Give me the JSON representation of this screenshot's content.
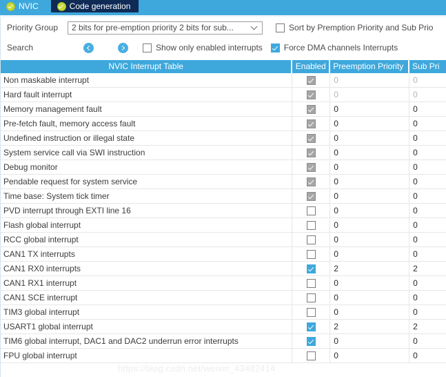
{
  "tabs": [
    {
      "label": "NVIC",
      "icon": "check-circle-icon",
      "active": true
    },
    {
      "label": "Code generation",
      "icon": "check-circle-icon",
      "active": false
    }
  ],
  "controls": {
    "priority_group_label": "Priority Group",
    "priority_group_value": "2 bits for pre-emption priority 2 bits for sub...",
    "sort_checkbox_label": "Sort by Premption Priority and Sub Prio",
    "sort_checkbox_checked": false,
    "search_label": "Search",
    "prev_icon": "chevron-left-circle-icon",
    "next_icon": "chevron-right-circle-icon",
    "show_enabled_label": "Show only enabled interrupts",
    "show_enabled_checked": false,
    "force_dma_label": "Force DMA channels Interrupts",
    "force_dma_checked": true
  },
  "table": {
    "headers": {
      "name": "NVIC Interrupt Table",
      "enabled": "Enabled",
      "preemption": "Preemption Priority",
      "sub": "Sub Pri"
    },
    "rows": [
      {
        "name": "Non maskable interrupt",
        "enabled": "checked-gray",
        "preemption": "0",
        "sub": "0",
        "dim": true
      },
      {
        "name": "Hard fault interrupt",
        "enabled": "checked-gray",
        "preemption": "0",
        "sub": "0",
        "dim": true
      },
      {
        "name": "Memory management fault",
        "enabled": "checked-gray",
        "preemption": "0",
        "sub": "0",
        "dim": false
      },
      {
        "name": "Pre-fetch fault, memory access fault",
        "enabled": "checked-gray",
        "preemption": "0",
        "sub": "0",
        "dim": false
      },
      {
        "name": "Undefined instruction or illegal state",
        "enabled": "checked-gray",
        "preemption": "0",
        "sub": "0",
        "dim": false
      },
      {
        "name": "System service call via SWI instruction",
        "enabled": "checked-gray",
        "preemption": "0",
        "sub": "0",
        "dim": false
      },
      {
        "name": "Debug monitor",
        "enabled": "checked-gray",
        "preemption": "0",
        "sub": "0",
        "dim": false
      },
      {
        "name": "Pendable request for system service",
        "enabled": "checked-gray",
        "preemption": "0",
        "sub": "0",
        "dim": false
      },
      {
        "name": "Time base: System tick timer",
        "enabled": "checked-gray",
        "preemption": "0",
        "sub": "0",
        "dim": false
      },
      {
        "name": "PVD interrupt through EXTI line 16",
        "enabled": "unchecked",
        "preemption": "0",
        "sub": "0",
        "dim": false
      },
      {
        "name": "Flash global interrupt",
        "enabled": "unchecked",
        "preemption": "0",
        "sub": "0",
        "dim": false
      },
      {
        "name": "RCC global interrupt",
        "enabled": "unchecked",
        "preemption": "0",
        "sub": "0",
        "dim": false
      },
      {
        "name": "CAN1 TX interrupts",
        "enabled": "unchecked",
        "preemption": "0",
        "sub": "0",
        "dim": false
      },
      {
        "name": "CAN1 RX0 interrupts",
        "enabled": "checked-blue",
        "preemption": "2",
        "sub": "2",
        "dim": false
      },
      {
        "name": "CAN1 RX1 interrupt",
        "enabled": "unchecked",
        "preemption": "0",
        "sub": "0",
        "dim": false
      },
      {
        "name": "CAN1 SCE interrupt",
        "enabled": "unchecked",
        "preemption": "0",
        "sub": "0",
        "dim": false
      },
      {
        "name": "TIM3 global interrupt",
        "enabled": "unchecked",
        "preemption": "0",
        "sub": "0",
        "dim": false
      },
      {
        "name": "USART1 global interrupt",
        "enabled": "checked-blue",
        "preemption": "2",
        "sub": "2",
        "dim": false
      },
      {
        "name": "TIM6 global interrupt, DAC1 and DAC2 underrun error interrupts",
        "enabled": "checked-blue",
        "preemption": "0",
        "sub": "0",
        "dim": false
      },
      {
        "name": "FPU global interrupt",
        "enabled": "unchecked",
        "preemption": "0",
        "sub": "0",
        "dim": false
      }
    ]
  },
  "watermark": "https://blog.csdn.net/weixin_43482414",
  "colors": {
    "accent": "#3ea8dc",
    "tab_inactive": "#0e2a55",
    "check_circle": "#c6d936"
  }
}
